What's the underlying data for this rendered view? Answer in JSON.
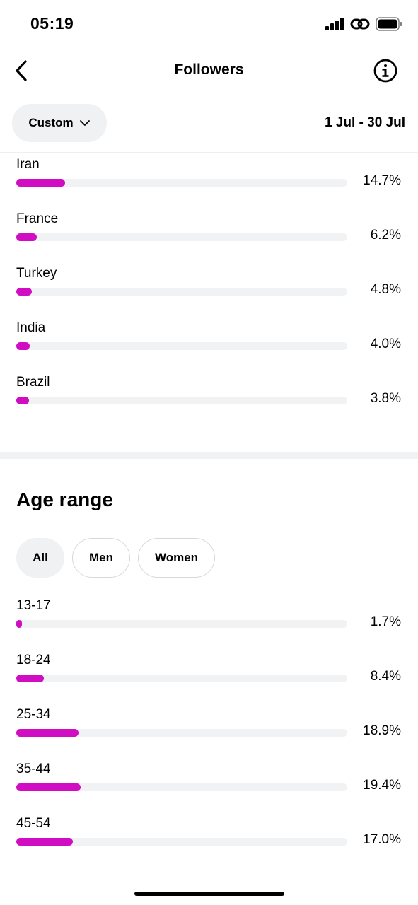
{
  "status_bar": {
    "time": "05:19",
    "icons": [
      "cellular-signal-icon",
      "personal-hotspot-icon",
      "battery-icon"
    ]
  },
  "nav": {
    "title": "Followers",
    "back_icon": "chevron-left-icon",
    "info_icon": "info-icon"
  },
  "filter": {
    "period_label": "Custom",
    "period_icon": "chevron-down-icon",
    "date_range": "1 Jul - 30 Jul"
  },
  "countries": [
    {
      "label": "Iran",
      "value_text": "14.7%",
      "value": 14.7
    },
    {
      "label": "France",
      "value_text": "6.2%",
      "value": 6.2
    },
    {
      "label": "Turkey",
      "value_text": "4.8%",
      "value": 4.8
    },
    {
      "label": "India",
      "value_text": "4.0%",
      "value": 4.0
    },
    {
      "label": "Brazil",
      "value_text": "3.8%",
      "value": 3.8
    }
  ],
  "age_section": {
    "title": "Age range",
    "filters": [
      "All",
      "Men",
      "Women"
    ],
    "selected_filter": "All"
  },
  "ages": [
    {
      "label": "13-17",
      "value_text": "1.7%",
      "value": 1.7
    },
    {
      "label": "18-24",
      "value_text": "8.4%",
      "value": 8.4
    },
    {
      "label": "25-34",
      "value_text": "18.9%",
      "value": 18.9
    },
    {
      "label": "35-44",
      "value_text": "19.4%",
      "value": 19.4
    },
    {
      "label": "45-54",
      "value_text": "17.0%",
      "value": 17.0
    }
  ],
  "colors": {
    "bar_fill": "#d10dc3",
    "bar_track": "#f1f2f4",
    "chip_selected": "#f0f1f3"
  }
}
